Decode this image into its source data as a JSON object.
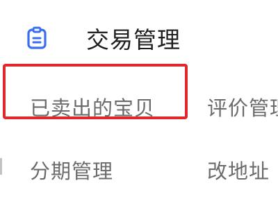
{
  "header": {
    "icon": "clipboard-icon",
    "title": "交易管理"
  },
  "menu": {
    "items": [
      {
        "label": "已卖出的宝贝"
      },
      {
        "label": "评价管理"
      },
      {
        "label": "分期管理"
      },
      {
        "label": "改地址"
      }
    ]
  },
  "colors": {
    "accent": "#3a6cf4",
    "highlight": "#e3262b",
    "text_primary": "#1f1f1f",
    "text_secondary": "#6b6b6b"
  }
}
